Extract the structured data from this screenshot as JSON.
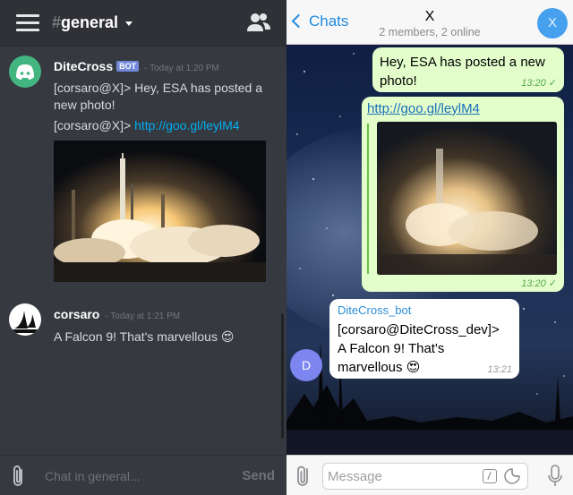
{
  "discord": {
    "header": {
      "hash": "#",
      "channel": "general",
      "members_icon": "members-icon",
      "menu_icon": "hamburger-icon"
    },
    "messages": [
      {
        "author": "DiteCross",
        "badge": "BOT",
        "timestamp": "- Today at 1:20 PM",
        "lines": [
          "[corsaro@X]> Hey, ESA has posted a",
          "new photo!"
        ],
        "link_prefix": "[corsaro@X]> ",
        "link": "http://goo.gl/leylM4",
        "image": "rocket-launch-photo"
      },
      {
        "author": "corsaro",
        "timestamp": "- Today at 1:21 PM",
        "text": "A Falcon 9! That's marvellous",
        "emoji": "😍"
      }
    ],
    "input": {
      "placeholder": "Chat in general...",
      "send_label": "Send"
    },
    "colors": {
      "background": "#36393f",
      "link": "#00b0f4",
      "bot_badge": "#7289da"
    }
  },
  "telegram": {
    "header": {
      "back_label": "Chats",
      "title": "X",
      "subtitle": "2 members, 2 online",
      "avatar_letter": "X"
    },
    "messages": [
      {
        "text": "Hey, ESA has posted a new photo!",
        "time": "13:20",
        "check": "✓"
      },
      {
        "link": "http://goo.gl/leylM4",
        "image": "blurred-rocket-preview",
        "time": "13:20",
        "check": "✓"
      },
      {
        "sender": "DiteCross_bot",
        "lines": [
          "[corsaro@DiteCross_dev]>",
          "A Falcon 9! That's",
          "marvellous"
        ],
        "emoji": "😍",
        "time": "13:21",
        "avatar_letter": "D"
      }
    ],
    "input": {
      "placeholder": "Message"
    },
    "colors": {
      "outgoing_bubble": "#e3fecb",
      "accent": "#1f8ae0"
    }
  }
}
